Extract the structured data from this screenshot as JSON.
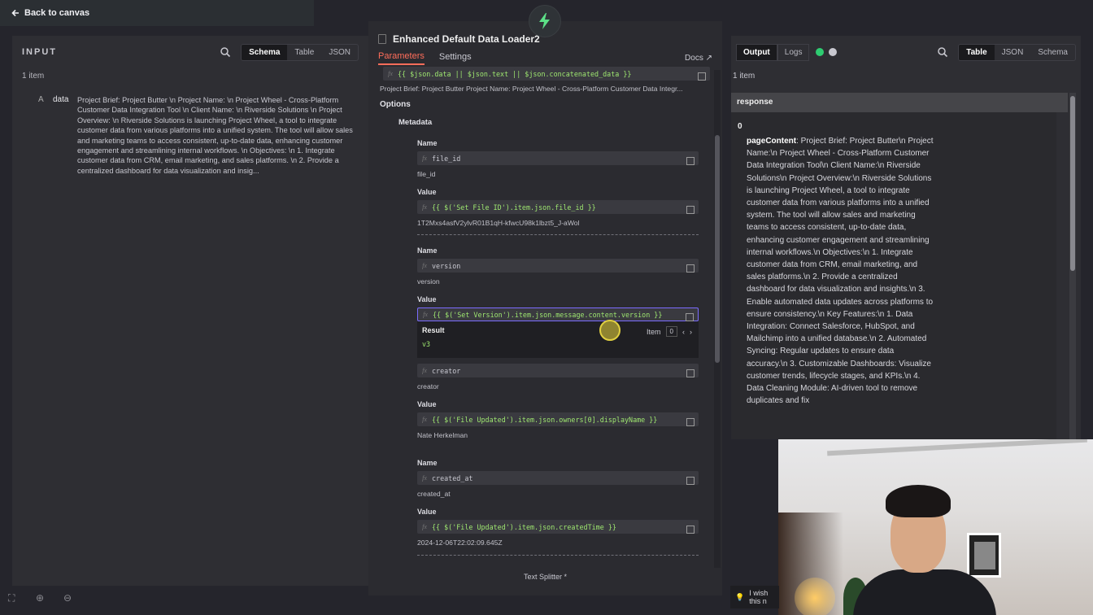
{
  "top": {
    "back_label": "Back to canvas"
  },
  "input": {
    "title": "INPUT",
    "tabs": [
      "Schema",
      "Table",
      "JSON"
    ],
    "active_tab": "Schema",
    "item_count": "1 item",
    "field": {
      "type": "A",
      "key": "data",
      "value": "Project Brief: Project Butter \\n Project Name: \\n Project Wheel - Cross-Platform Customer Data Integration Tool \\n Client Name: \\n Riverside Solutions \\n Project Overview: \\n Riverside Solutions is launching Project Wheel, a tool to integrate customer data from various platforms into a unified system. The tool will allow sales and marketing teams to access consistent, up-to-date data, enhancing customer engagement and streamlining internal workflows. \\n Objectives: \\n 1. Integrate customer data from CRM, email marketing, and sales platforms. \\n 2. Provide a centralized dashboard for data visualization and insig..."
    }
  },
  "modal": {
    "title": "Enhanced Default Data Loader2",
    "tabs": {
      "parameters": "Parameters",
      "settings": "Settings"
    },
    "docs": "Docs",
    "top_expr": "{{ $json.data || $json.text || $json.concatenated_data }}",
    "top_preview": "Project Brief: Project Butter Project Name: Project Wheel - Cross-Platform Customer Data Integr...",
    "options": "Options",
    "metadata": "Metadata",
    "name_label": "Name",
    "value_label": "Value",
    "fx": "fx",
    "entries": [
      {
        "name": "file_id",
        "name_preview": "file_id",
        "value": "{{ $('Set File ID').item.json.file_id }}",
        "value_preview": "1T2Mxs4asfV2ylvR01B1qH-kfwcU98k1lbzt5_J-aWol"
      },
      {
        "name": "version",
        "name_preview": "version",
        "value": "{{ $('Set Version').item.json.message.content.version }}"
      },
      {
        "name": "creator",
        "name_preview": "creator",
        "value": "{{ $('File Updated').item.json.owners[0].displayName }}",
        "value_preview": "Nate Herkelman"
      },
      {
        "name": "created_at",
        "name_preview": "created_at",
        "value": "{{ $('File Updated').item.json.createdTime }}",
        "value_preview": "2024-12-06T22:02:09.645Z"
      }
    ],
    "result": {
      "title": "Result",
      "value": "v3",
      "item_label": "Item",
      "item_index": "0"
    },
    "footer": "Text Splitter *"
  },
  "output": {
    "tabs": [
      "Output",
      "Logs"
    ],
    "view_tabs": [
      "Table",
      "JSON",
      "Schema"
    ],
    "active_view": "Table",
    "item_count": "1 item",
    "column": "response",
    "row_index": "0",
    "key": "pageContent",
    "value": ": Project Brief: Project Butter\\n Project Name:\\n Project Wheel - Cross-Platform Customer Data Integration Tool\\n Client Name:\\n Riverside Solutions\\n Project Overview:\\n Riverside Solutions is launching Project Wheel, a tool to integrate customer data from various platforms into a unified system. The tool will allow sales and marketing teams to access consistent, up-to-date data, enhancing customer engagement and streamlining internal workflows.\\n Objectives:\\n 1. Integrate customer data from CRM, email marketing, and sales platforms.\\n 2. Provide a centralized dashboard for data visualization and insights.\\n 3. Enable automated data updates across platforms to ensure consistency.\\n Key Features:\\n 1. Data Integration: Connect Salesforce, HubSpot, and Mailchimp into a unified database.\\n 2. Automated Syncing: Regular updates to ensure data accuracy.\\n 3. Customizable Dashboards: Visualize customer trends, lifecycle stages, and KPIs.\\n 4. Data Cleaning Module: AI-driven tool to remove duplicates and fix"
  },
  "wish": "I wish this n",
  "colors": {
    "accent": "#ff6d5a",
    "expr_green": "#9fe870",
    "success": "#2ecc71"
  }
}
